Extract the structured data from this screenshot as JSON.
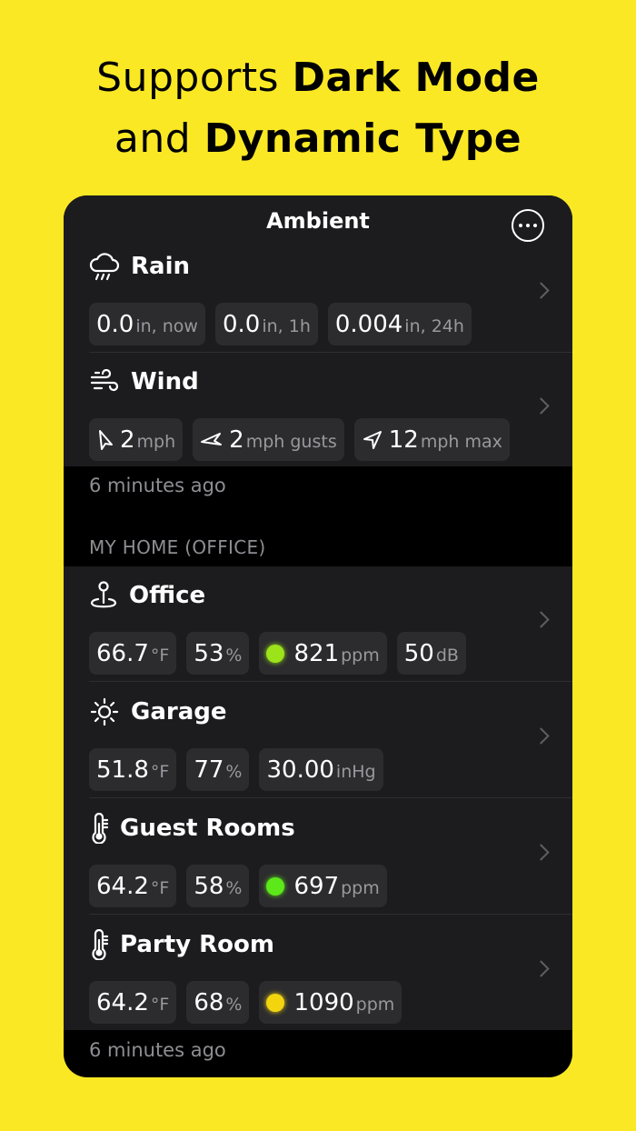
{
  "promo": {
    "line1_plain": "Supports ",
    "line1_bold": "Dark Mode",
    "line2_plain": "and ",
    "line2_bold": "Dynamic Type"
  },
  "nav": {
    "title": "Ambient",
    "more_icon": "ellipsis-circle-icon"
  },
  "section1": {
    "rows": [
      {
        "icon": "cloud-rain-icon",
        "title": "Rain",
        "chips": [
          {
            "value": "0.0",
            "unit": "in, now"
          },
          {
            "value": "0.0",
            "unit": "in, 1h"
          },
          {
            "value": "0.004",
            "unit": "in, 24h"
          }
        ]
      },
      {
        "icon": "wind-icon",
        "title": "Wind",
        "chips": [
          {
            "icon": "wind-direction-arrow-icon",
            "value": "2",
            "unit": "mph"
          },
          {
            "icon": "wind-gust-icon",
            "value": "2",
            "unit": "mph gusts"
          },
          {
            "icon": "location-arrow-icon",
            "value": "12",
            "unit": "mph max"
          }
        ]
      }
    ],
    "footer": "6 minutes ago"
  },
  "section2": {
    "header": "MY HOME (OFFICE)",
    "rows": [
      {
        "icon": "pin-location-icon",
        "title": "Office",
        "chips": [
          {
            "value": "66.7",
            "unit": "°F"
          },
          {
            "value": "53",
            "unit": "%"
          },
          {
            "dot_color": "#9CE31A",
            "value": "821",
            "unit": "ppm"
          },
          {
            "value": "50",
            "unit": "dB"
          }
        ]
      },
      {
        "icon": "sun-icon",
        "title": "Garage",
        "chips": [
          {
            "value": "51.8",
            "unit": "°F"
          },
          {
            "value": "77",
            "unit": "%"
          },
          {
            "value": "30.00",
            "unit": "inHg"
          }
        ]
      },
      {
        "icon": "thermometer-icon",
        "title": "Guest Rooms",
        "chips": [
          {
            "value": "64.2",
            "unit": "°F"
          },
          {
            "value": "58",
            "unit": "%"
          },
          {
            "dot_color": "#5DE81A",
            "value": "697",
            "unit": "ppm"
          }
        ]
      },
      {
        "icon": "thermometer-icon",
        "title": "Party Room",
        "chips": [
          {
            "value": "64.2",
            "unit": "°F"
          },
          {
            "value": "68",
            "unit": "%"
          },
          {
            "dot_color": "#F2D50F",
            "value": "1090",
            "unit": "ppm"
          }
        ]
      }
    ],
    "footer": "6 minutes ago"
  },
  "colors": {
    "background": "#FAE824",
    "card": "#1C1C1E",
    "chip": "#2C2C2E",
    "secondary_text": "#8E8E93"
  }
}
